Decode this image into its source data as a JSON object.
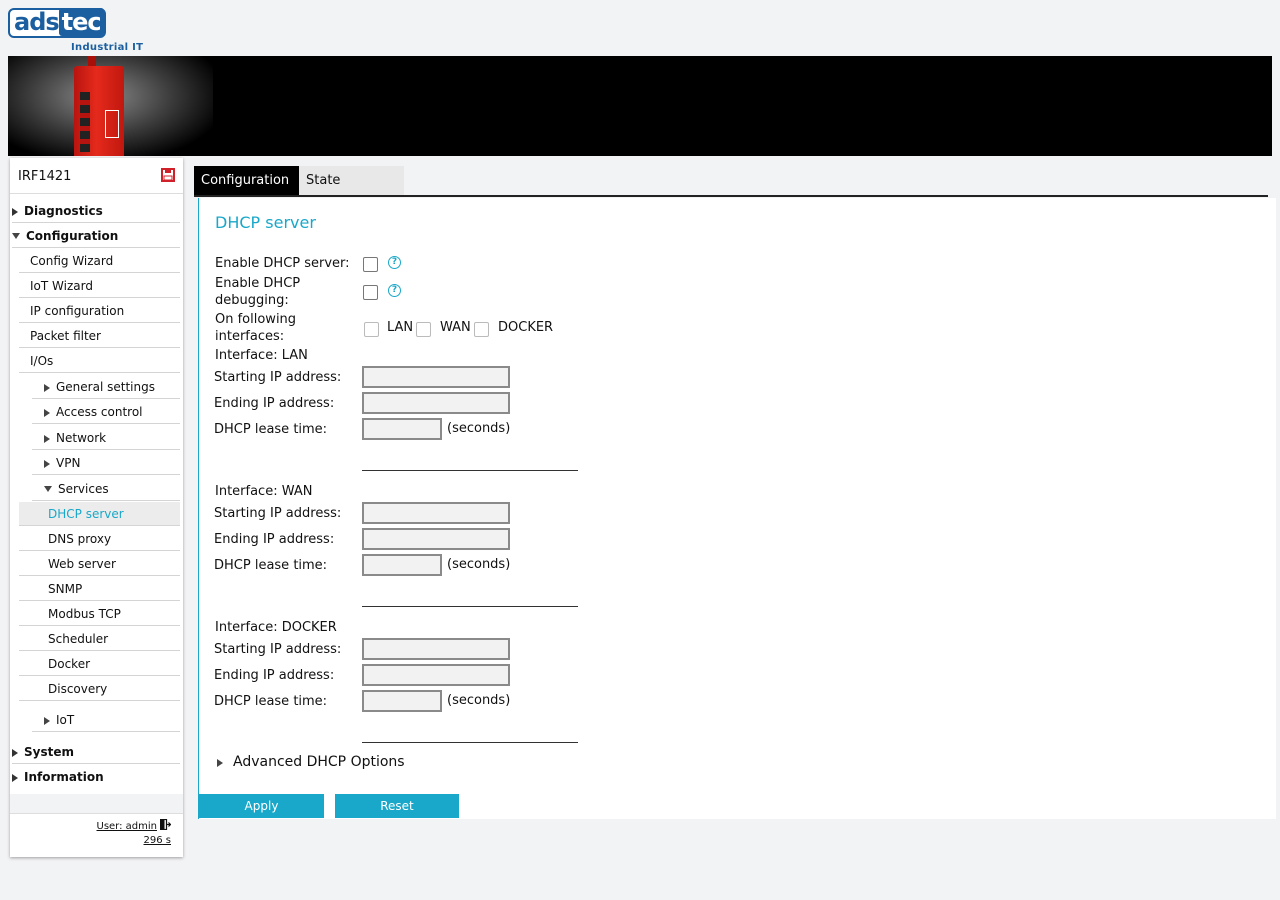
{
  "logo": {
    "brand_a": "ads",
    "brand_b": "tec",
    "tagline": "Industrial IT"
  },
  "device_name": "IRF1421",
  "sidebar": {
    "diagnostics": "Diagnostics",
    "configuration": "Configuration",
    "config_wizard": "Config Wizard",
    "iot_wizard": "IoT Wizard",
    "ip_configuration": "IP configuration",
    "packet_filter": "Packet filter",
    "ios": "I/Os",
    "general_settings": "General settings",
    "access_control": "Access control",
    "network": "Network",
    "vpn": "VPN",
    "services": "Services",
    "dhcp_server": "DHCP server",
    "dns_proxy": "DNS proxy",
    "web_server": "Web server",
    "snmp": "SNMP",
    "modbus_tcp": "Modbus TCP",
    "scheduler": "Scheduler",
    "docker": "Docker",
    "discovery": "Discovery",
    "iot": "IoT",
    "system": "System",
    "information": "Information"
  },
  "footer": {
    "user": "User: admin",
    "timer": "296 s"
  },
  "tabs": {
    "configuration": "Configuration",
    "state": "State"
  },
  "content": {
    "title": "DHCP server",
    "enable_dhcp": "Enable DHCP server:",
    "enable_debug": "Enable DHCP debugging:",
    "interfaces_label": "On following interfaces:",
    "if_lan": "LAN",
    "if_wan": "WAN",
    "if_docker": "DOCKER",
    "help_glyph": "?",
    "seconds": "(seconds)",
    "starting_ip": "Starting IP address:",
    "ending_ip": "Ending IP address:",
    "lease_time": "DHCP lease time:",
    "lan_header": "Interface: LAN",
    "wan_header": "Interface: WAN",
    "docker_header": "Interface: DOCKER",
    "advanced": "Advanced DHCP Options",
    "apply": "Apply",
    "reset": "Reset"
  }
}
